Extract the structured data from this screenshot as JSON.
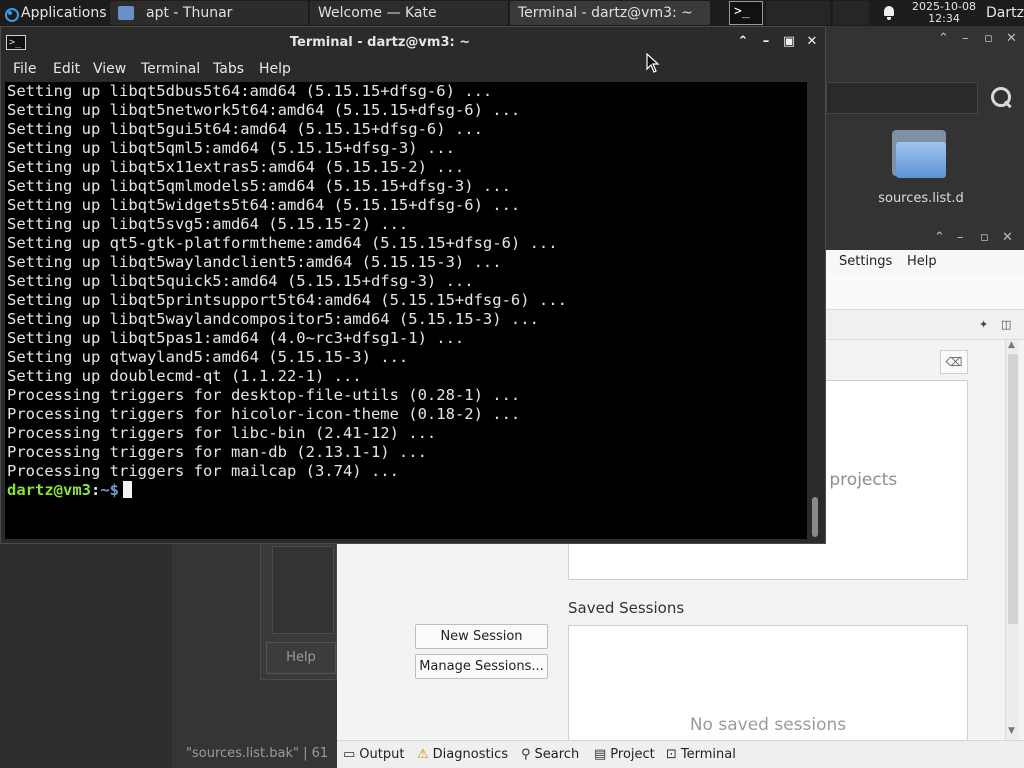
{
  "panel": {
    "applications_label": "Applications",
    "tasks": [
      {
        "label": "apt - Thunar"
      },
      {
        "label": "Welcome  — Kate"
      },
      {
        "label": "Terminal - dartz@vm3: ~"
      }
    ],
    "clock_date": "2025-10-08",
    "clock_time": "12:34",
    "user": "Dartz"
  },
  "terminal": {
    "title": "Terminal - dartz@vm3: ~",
    "menu": [
      "File",
      "Edit",
      "View",
      "Terminal",
      "Tabs",
      "Help"
    ],
    "lines": [
      "Setting up libqt5dbus5t64:amd64 (5.15.15+dfsg-6) ...",
      "Setting up libqt5network5t64:amd64 (5.15.15+dfsg-6) ...",
      "Setting up libqt5gui5t64:amd64 (5.15.15+dfsg-6) ...",
      "Setting up libqt5qml5:amd64 (5.15.15+dfsg-3) ...",
      "Setting up libqt5x11extras5:amd64 (5.15.15-2) ...",
      "Setting up libqt5qmlmodels5:amd64 (5.15.15+dfsg-3) ...",
      "Setting up libqt5widgets5t64:amd64 (5.15.15+dfsg-6) ...",
      "Setting up libqt5svg5:amd64 (5.15.15-2) ...",
      "Setting up qt5-gtk-platformtheme:amd64 (5.15.15+dfsg-6) ...",
      "Setting up libqt5waylandclient5:amd64 (5.15.15-3) ...",
      "Setting up libqt5quick5:amd64 (5.15.15+dfsg-3) ...",
      "Setting up libqt5printsupport5t64:amd64 (5.15.15+dfsg-6) ...",
      "Setting up libqt5waylandcompositor5:amd64 (5.15.15-3) ...",
      "Setting up libqt5pas1:amd64 (4.0~rc3+dfsg1-1) ...",
      "Setting up qtwayland5:amd64 (5.15.15-3) ...",
      "Setting up doublecmd-qt (1.1.22-1) ...",
      "Processing triggers for desktop-file-utils (0.28-1) ...",
      "Processing triggers for hicolor-icon-theme (0.18-2) ...",
      "Processing triggers for libc-bin (2.41-12) ...",
      "Processing triggers for man-db (2.13.1-1) ...",
      "Processing triggers for mailcap (3.74) ..."
    ],
    "prompt_user": "dartz@vm3",
    "prompt_sep": ":",
    "prompt_path": "~$"
  },
  "thunar": {
    "folder_label": "sources.list.d",
    "help_label": "Help",
    "status_text": "\"sources.list.bak\"  |  61"
  },
  "kate": {
    "menu_settings": "Settings",
    "menu_help": "Help",
    "projects_text": "r projects",
    "new_session": "New Session",
    "manage_sessions": "Manage Sessions...",
    "saved_sessions_title": "Saved Sessions",
    "no_saved_sessions": "No saved sessions",
    "bottom_tabs": [
      "Output",
      "Diagnostics",
      "Search",
      "Project",
      "Terminal"
    ]
  },
  "colors": {
    "prompt_user": "#8ae234",
    "prompt_path": "#729fcf",
    "terminal_bg": "#000000",
    "panel_bg": "#1c1c1c"
  }
}
